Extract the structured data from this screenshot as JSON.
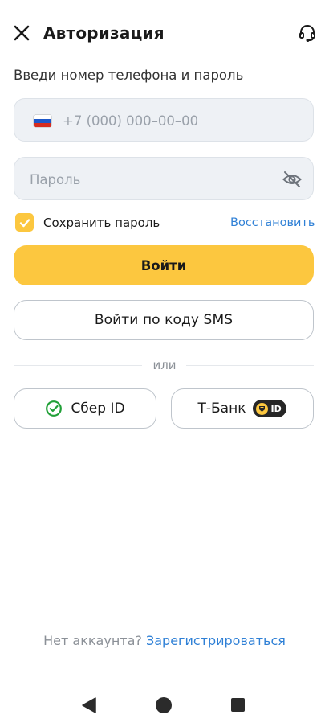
{
  "header": {
    "title": "Авторизация",
    "close_icon": "close-icon",
    "support_icon": "headset-icon"
  },
  "instruction": {
    "prefix": "Введи ",
    "link_text": "номер телефона",
    "suffix": " и пароль"
  },
  "phone": {
    "flag_icon": "russia-flag-icon",
    "placeholder": "+7 (000) 000–00–00",
    "value": ""
  },
  "password": {
    "placeholder": "Пароль",
    "value": "",
    "visibility_icon": "eye-off-icon"
  },
  "save_password": {
    "label": "Сохранить пароль",
    "checked": true
  },
  "restore_link": "Восстановить",
  "buttons": {
    "login": "Войти",
    "sms_login": "Войти по коду SMS"
  },
  "divider_text": "или",
  "social": {
    "sber": {
      "label": "Сбер ID",
      "icon": "sber-check-icon"
    },
    "tbank": {
      "label": "Т‑Банк",
      "badge": "ID",
      "icon": "tbank-shield-icon"
    }
  },
  "footer": {
    "question": "Нет аккаунта?",
    "register_link": "Зарегистрироваться"
  },
  "colors": {
    "accent_yellow": "#fcc73f",
    "link_blue": "#2f80d6",
    "sber_green": "#21a038",
    "input_bg": "#eef1f5"
  },
  "nav": {
    "back_icon": "nav-back-icon",
    "home_icon": "nav-home-icon",
    "recent_icon": "nav-recent-icon"
  }
}
